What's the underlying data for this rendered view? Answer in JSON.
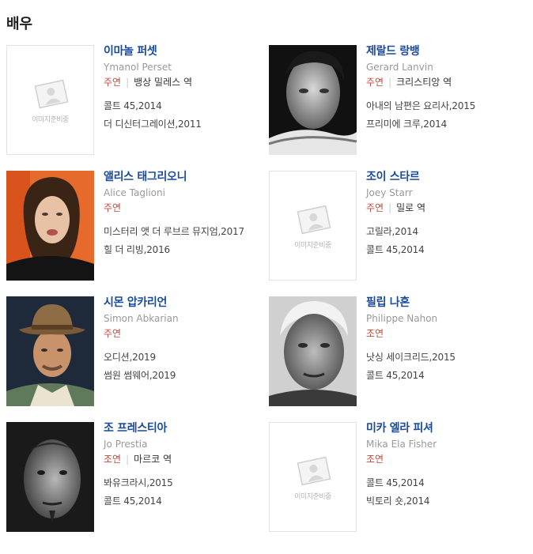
{
  "section": {
    "title": "배우"
  },
  "placeholder_text": "이미지준비중",
  "actors": [
    {
      "name_ko": "이마놀 퍼셋",
      "name_en": "Ymanol Perset",
      "role": "주연",
      "character": "뱅상 밀레스 역",
      "works": [
        "콜트 45,2014",
        "더 디신터그레이션,2011"
      ],
      "image": "placeholder"
    },
    {
      "name_ko": "제랄드 랑뱅",
      "name_en": "Gerard Lanvin",
      "role": "주연",
      "character": "크리스티앙 역",
      "works": [
        "아내의 남편은 요리사,2015",
        "프리미에 크루,2014"
      ],
      "image": "photo"
    },
    {
      "name_ko": "앨리스 태그리오니",
      "name_en": "Alice Taglioni",
      "role": "주연",
      "character": "",
      "works": [
        "미스터리 앳 더 루브르 뮤지엄,2017",
        "힐 더 리빙,2016"
      ],
      "image": "photo"
    },
    {
      "name_ko": "조이 스타르",
      "name_en": "Joey Starr",
      "role": "주연",
      "character": "밀로 역",
      "works": [
        "고릴라,2014",
        "콜트 45,2014"
      ],
      "image": "placeholder"
    },
    {
      "name_ko": "시몬 압카리언",
      "name_en": "Simon Abkarian",
      "role": "주연",
      "character": "",
      "works": [
        "오디션,2019",
        "썸원 썸웨어,2019"
      ],
      "image": "photo"
    },
    {
      "name_ko": "필립 나혼",
      "name_en": "Philippe Nahon",
      "role": "조연",
      "character": "",
      "works": [
        "낫싱 세이크리드,2015",
        "콜트 45,2014"
      ],
      "image": "photo"
    },
    {
      "name_ko": "조 프레스티아",
      "name_en": "Jo Prestia",
      "role": "조연",
      "character": "마르코 역",
      "works": [
        "봐유크라시,2015",
        "콜트 45,2014"
      ],
      "image": "photo"
    },
    {
      "name_ko": "미카 엘라 피셔",
      "name_en": "Mika Ela Fisher",
      "role": "조연",
      "character": "",
      "works": [
        "콜트 45,2014",
        "빅토리 숏,2014"
      ],
      "image": "placeholder"
    }
  ]
}
